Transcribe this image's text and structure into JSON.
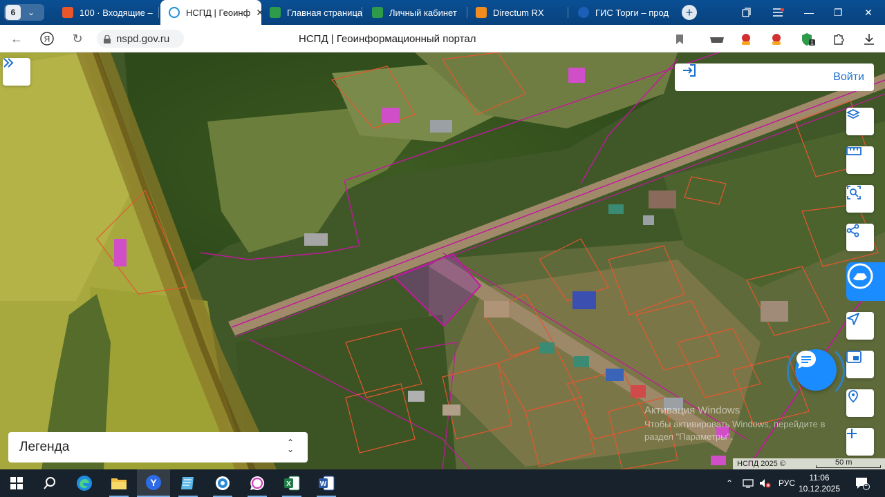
{
  "browser": {
    "tab_count": "6",
    "tabs": [
      {
        "title": "100 · Входящие –",
        "icon_color": "#e8562a"
      },
      {
        "title": "НСПД | Геоинф",
        "icon_color": "#1b8fd6"
      },
      {
        "title": "Главная страница",
        "icon_color": "#2e9b4b"
      },
      {
        "title": "Личный кабинет",
        "icon_color": "#2e9b4b"
      },
      {
        "title": "Directum RX",
        "icon_color": "#f28c1e"
      },
      {
        "title": "ГИС Торги – прод",
        "icon_color": "#1c5fb8"
      }
    ],
    "active_tab_index": 1,
    "url": "nspd.gov.ru",
    "page_title": "НСПД | Геоинформационный портал"
  },
  "map": {
    "login_label": "Войти",
    "legend_label": "Легенда",
    "attribution": "НСПД 2025 ©",
    "scale_label": "50 m",
    "watermark_line1": "Активация Windows",
    "watermark_line2": "Чтобы активировать Windows, перейдите в",
    "watermark_line3": "раздел \"Параметры\"."
  },
  "taskbar": {
    "language": "РУС",
    "time": "11:06",
    "date": "10.12.2025",
    "notifications": "1"
  },
  "colors": {
    "accent": "#1b6fd1",
    "map_blue": "#1a8cff",
    "parcel_orange": "#e4572e",
    "boundary_magenta": "#c2189e",
    "zone_yellow": "#d8d040"
  }
}
